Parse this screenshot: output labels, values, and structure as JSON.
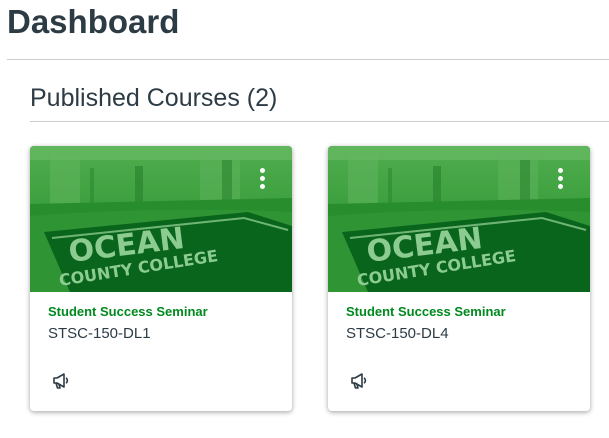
{
  "page": {
    "title": "Dashboard"
  },
  "section": {
    "title": "Published Courses (2)"
  },
  "courses": [
    {
      "name": "Student Success Seminar",
      "code": "STSC-150-DL1",
      "hero_text_line1": "OCEAN",
      "hero_text_line2": "COUNTY COLLEGE",
      "options_icon": "kebab-menu-icon",
      "action_icon": "megaphone-icon"
    },
    {
      "name": "Student Success Seminar",
      "code": "STSC-150-DL4",
      "hero_text_line1": "OCEAN",
      "hero_text_line2": "COUNTY COLLEGE",
      "options_icon": "kebab-menu-icon",
      "action_icon": "megaphone-icon"
    }
  ],
  "colors": {
    "course_name": "#00891e",
    "hero_tint": "#2f8d3a",
    "text": "#2d3b45"
  }
}
